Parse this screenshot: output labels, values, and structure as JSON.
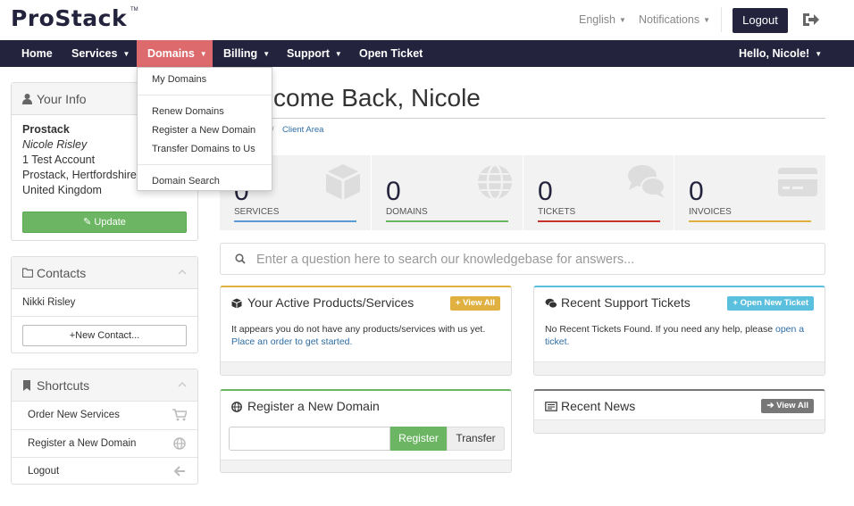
{
  "brand": {
    "name": "ProStack",
    "tm": "TM"
  },
  "header": {
    "language": "English",
    "notifications": "Notifications",
    "logout": "Logout"
  },
  "nav": {
    "items": [
      {
        "label": "Home"
      },
      {
        "label": "Services"
      },
      {
        "label": "Domains"
      },
      {
        "label": "Billing"
      },
      {
        "label": "Support"
      },
      {
        "label": "Open Ticket"
      }
    ],
    "greeting": "Hello, Nicole!"
  },
  "domains_menu": {
    "items": [
      "My Domains",
      "Renew Domains",
      "Register a New Domain",
      "Transfer Domains to Us",
      "Domain Search"
    ]
  },
  "your_info": {
    "title": "Your Info",
    "company": "Prostack",
    "name": "Nicole Risley",
    "address1": "1 Test Account",
    "address2": "Prostack, Hertfordshire",
    "country": "United Kingdom",
    "update_button": "Update"
  },
  "contacts": {
    "title": "Contacts",
    "items": [
      "Nikki Risley"
    ],
    "new_button": "New Contact..."
  },
  "shortcuts": {
    "title": "Shortcuts",
    "items": [
      {
        "label": "Order New Services",
        "icon": "cart-icon"
      },
      {
        "label": "Register a New Domain",
        "icon": "globe-icon"
      },
      {
        "label": "Logout",
        "icon": "arrow-left-icon"
      }
    ]
  },
  "main": {
    "welcome": "come Back, Nicole",
    "breadcrumb_sep": "/",
    "breadcrumb_current": "Client Area"
  },
  "stats": [
    {
      "value": "0",
      "label": "SERVICES",
      "color": "#5b9bd5",
      "icon": "cube-icon"
    },
    {
      "value": "0",
      "label": "DOMAINS",
      "color": "#6cb563",
      "icon": "globe-icon"
    },
    {
      "value": "0",
      "label": "TICKETS",
      "color": "#c9302c",
      "icon": "comments-icon"
    },
    {
      "value": "0",
      "label": "INVOICES",
      "color": "#e0b040",
      "icon": "credit-card-icon"
    }
  ],
  "kb_search": {
    "placeholder": "Enter a question here to search our knowledgebase for answers..."
  },
  "products": {
    "title": "Your Active Products/Services",
    "button": "View All",
    "body_text": "It appears you do not have any products/services with us yet.",
    "body_link": "Place an order to get started.",
    "accent": "#e0b040"
  },
  "tickets": {
    "title": "Recent Support Tickets",
    "button": "Open New Ticket",
    "body_text": "No Recent Tickets Found. If you need any help, please",
    "body_link": "open a ticket.",
    "accent": "#5bc0de"
  },
  "register": {
    "title": "Register a New Domain",
    "register_button": "Register",
    "transfer_button": "Transfer",
    "accent": "#6cb563"
  },
  "news": {
    "title": "Recent News",
    "button": "View All",
    "accent": "#777777"
  }
}
